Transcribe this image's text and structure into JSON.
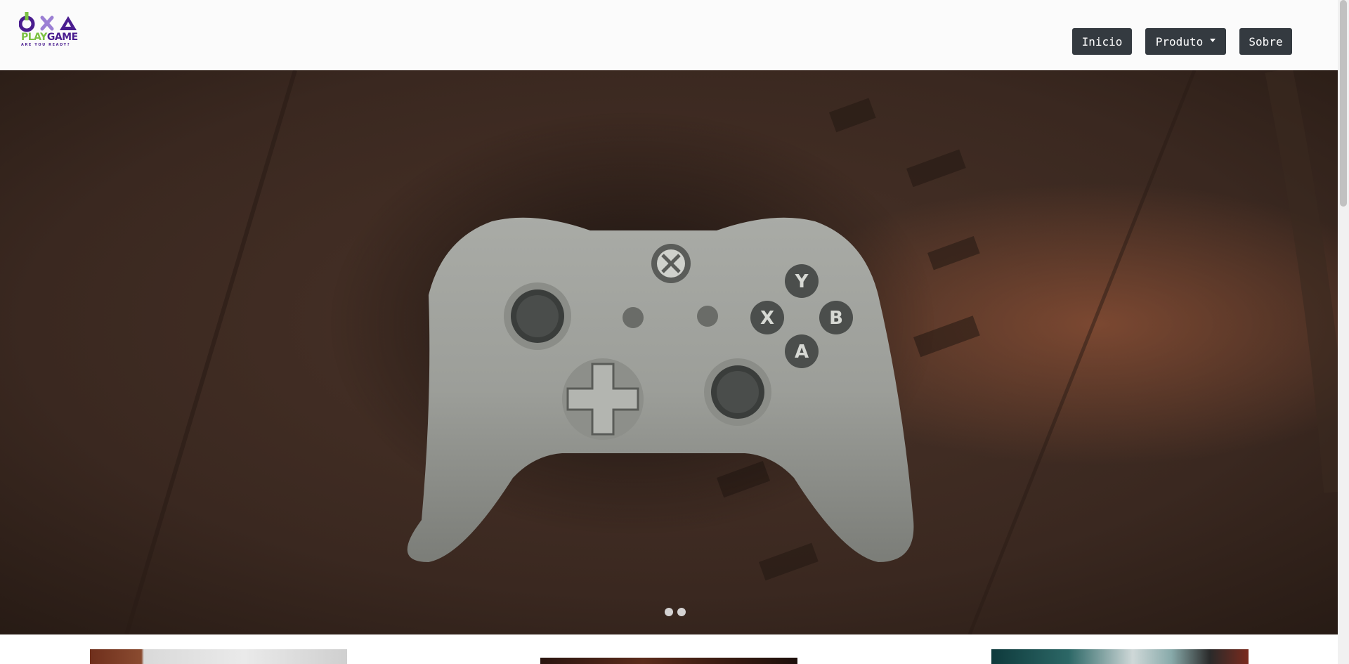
{
  "brand": {
    "name_part1": "PLAY",
    "name_part2": "GAME",
    "tagline": "ARE YOU READY?",
    "colors": {
      "green": "#7bc142",
      "purple": "#4a1d8f"
    }
  },
  "nav": {
    "items": [
      {
        "label": "Inicio"
      },
      {
        "label": "Produto",
        "has_dropdown": true
      },
      {
        "label": "Sobre"
      }
    ],
    "button_color": "#343a40"
  },
  "carousel": {
    "image_description_icon": "xbox-controller-photo",
    "slide_count": 2,
    "active_index": 0
  },
  "thumbnails": [
    {
      "icon": "product-image"
    },
    {
      "icon": "product-image"
    },
    {
      "icon": "product-image"
    }
  ]
}
